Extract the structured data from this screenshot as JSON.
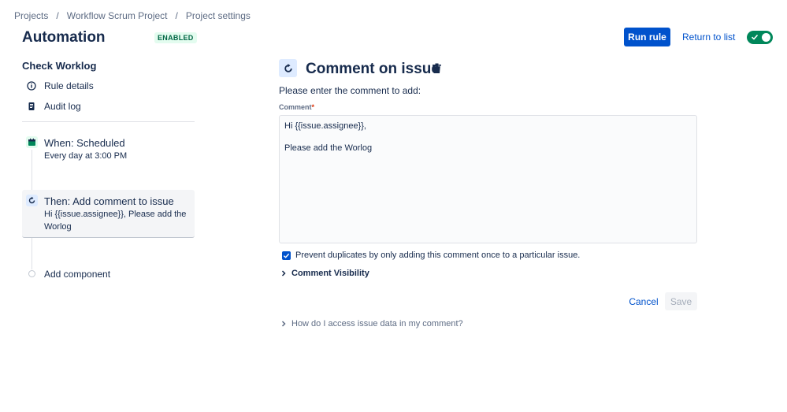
{
  "breadcrumb": {
    "items": [
      "Projects",
      "Workflow Scrum Project",
      "Project settings"
    ],
    "separator": "/"
  },
  "header": {
    "title": "Automation",
    "status": "ENABLED",
    "run_label": "Run rule",
    "return_label": "Return to list",
    "toggle_on": true
  },
  "sidebar": {
    "rule_name": "Check Worklog",
    "links": [
      {
        "label": "Rule details",
        "icon": "info-icon"
      },
      {
        "label": "Audit log",
        "icon": "document-icon"
      }
    ],
    "steps": [
      {
        "title": "When: Scheduled",
        "subtitle": "Every day at 3:00 PM",
        "icon": "calendar-icon"
      },
      {
        "title": "Then: Add comment to issue",
        "subtitle_line1": "Hi {{issue.assignee}}, Please add the",
        "subtitle_line2": "Worlog",
        "icon": "comment-action-icon"
      }
    ],
    "add_component_label": "Add component"
  },
  "main": {
    "title": "Comment on issue",
    "instruction": "Please enter the comment to add:",
    "field_label": "Comment",
    "required_mark": "*",
    "comment_lines": [
      "Hi {{issue.assignee}},",
      "",
      "Please add the Worlog"
    ],
    "prevent_duplicates_label": "Prevent duplicates by only adding this comment once to a particular issue.",
    "prevent_duplicates_checked": true,
    "visibility_label": "Comment Visibility",
    "cancel_label": "Cancel",
    "save_label": "Save",
    "help_label": "How do I access issue data in my comment?"
  },
  "colors": {
    "primary": "#0052cc",
    "success": "#00875a",
    "text": "#172b4d",
    "muted": "#5e6c84"
  }
}
